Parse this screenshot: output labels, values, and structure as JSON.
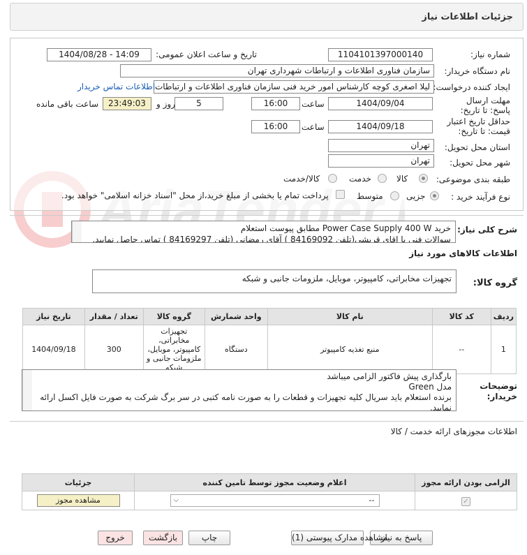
{
  "header": {
    "title": "جزئیات اطلاعات نیاز"
  },
  "watermark": {
    "text": "AriaTender.net"
  },
  "form": {
    "need_number_label": "شماره نیاز:",
    "need_number": "1104101397000140",
    "announce_label": "تاریخ و ساعت اعلان عمومی:",
    "announce_value": "1404/08/28 - 14:09",
    "buyer_label": "نام دستگاه خریدار:",
    "buyer_value": "سازمان فناوری اطلاعات و ارتباطات شهرداری تهران",
    "requester_label": "ایجاد کننده درخواست:",
    "requester_value": "لیلا اصغری کوچه کارشناس امور خرید فنی سازمان فناوری اطلاعات و ارتباطات ش",
    "contact_link": "اطلاعات تماس خریدار",
    "deadline_label": "مهلت ارسال پاسخ: تا تاریخ:",
    "deadline_date": "1404/09/04",
    "time_label": "ساعت",
    "deadline_time": "16:00",
    "days_value": "5",
    "days_label": "روز و",
    "remaining_time": "23:49:03",
    "remaining_label": "ساعت باقی مانده",
    "validity_label": "حداقل تاریخ اعتبار قیمت: تا تاریخ:",
    "validity_date": "1404/09/18",
    "validity_time": "16:00",
    "province_label": "استان محل تحویل:",
    "province_value": "تهران",
    "city_label": "شهر محل تحویل:",
    "city_value": "تهران",
    "category_label": "طبقه بندی موضوعی:",
    "category_options": [
      "کالا",
      "خدمت",
      "کالا/خدمت"
    ],
    "category_selected": "کالا",
    "process_label": "نوع فرآیند خرید :",
    "process_options": [
      "جزیی",
      "متوسط"
    ],
    "process_selected": "جزیی",
    "payment_text": "پرداخت تمام یا بخشی از مبلغ خرید،از محل \"اسناد خزانه اسلامی\" خواهد بود."
  },
  "summary": {
    "label": "شرح کلی نیاز:",
    "line1": "خرید Power Case Supply 400 W مطابق پیوست استعلام",
    "line2": "سوالات فنی با اقای قریشی(تلفن 84169092 ) آقای رمضانی (تلفن 84169297 ) تماس حاصل نمایید."
  },
  "goods_info": {
    "title": "اطلاعات کالاهای مورد نیاز",
    "group_label": "گروه کالا:",
    "group_value": "تجهیزات مخابراتی، کامپیوتر، موبایل، ملزومات جانبی و شبکه",
    "columns": [
      "ردیف",
      "کد کالا",
      "نام کالا",
      "واحد شمارش",
      "گروه کالا",
      "تعداد / مقدار",
      "تاریخ نیاز"
    ],
    "rows": [
      [
        "1",
        "--",
        "منبع تغذیه کامپیوتر",
        "دستگاه",
        "تجهیزات مخابراتی، کامپیوتر، موبایل، ملزومات جانبی و شبکه",
        "300",
        "1404/09/18"
      ]
    ]
  },
  "buyer_notes": {
    "label": "توضیحات خریدار:",
    "line1": "بارگذاری پیش فاکتور الزامی میباشد",
    "line2": "مدل Green",
    "line3": "برنده استعلام باید سریال کلیه تجهیزات و قطعات را به صورت نامه کتبی در سر برگ شرکت به صورت فایل اکسل ارائه نمایید."
  },
  "licenses": {
    "title": "اطلاعات مجوزهای ارائه خدمت / کالا",
    "columns": [
      "الزامی بودن ارائه مجوز",
      "اعلام وضعیت مجوز توسط تامین کننده",
      "جزئیات"
    ],
    "select_value": "--",
    "view_button": "مشاهده مجوز"
  },
  "footer": {
    "reply": "پاسخ به نیاز",
    "attachments": "مشاهده مدارک پیوستی (1)",
    "print": "چاپ",
    "back": "بازگشت",
    "exit": "خروج"
  }
}
